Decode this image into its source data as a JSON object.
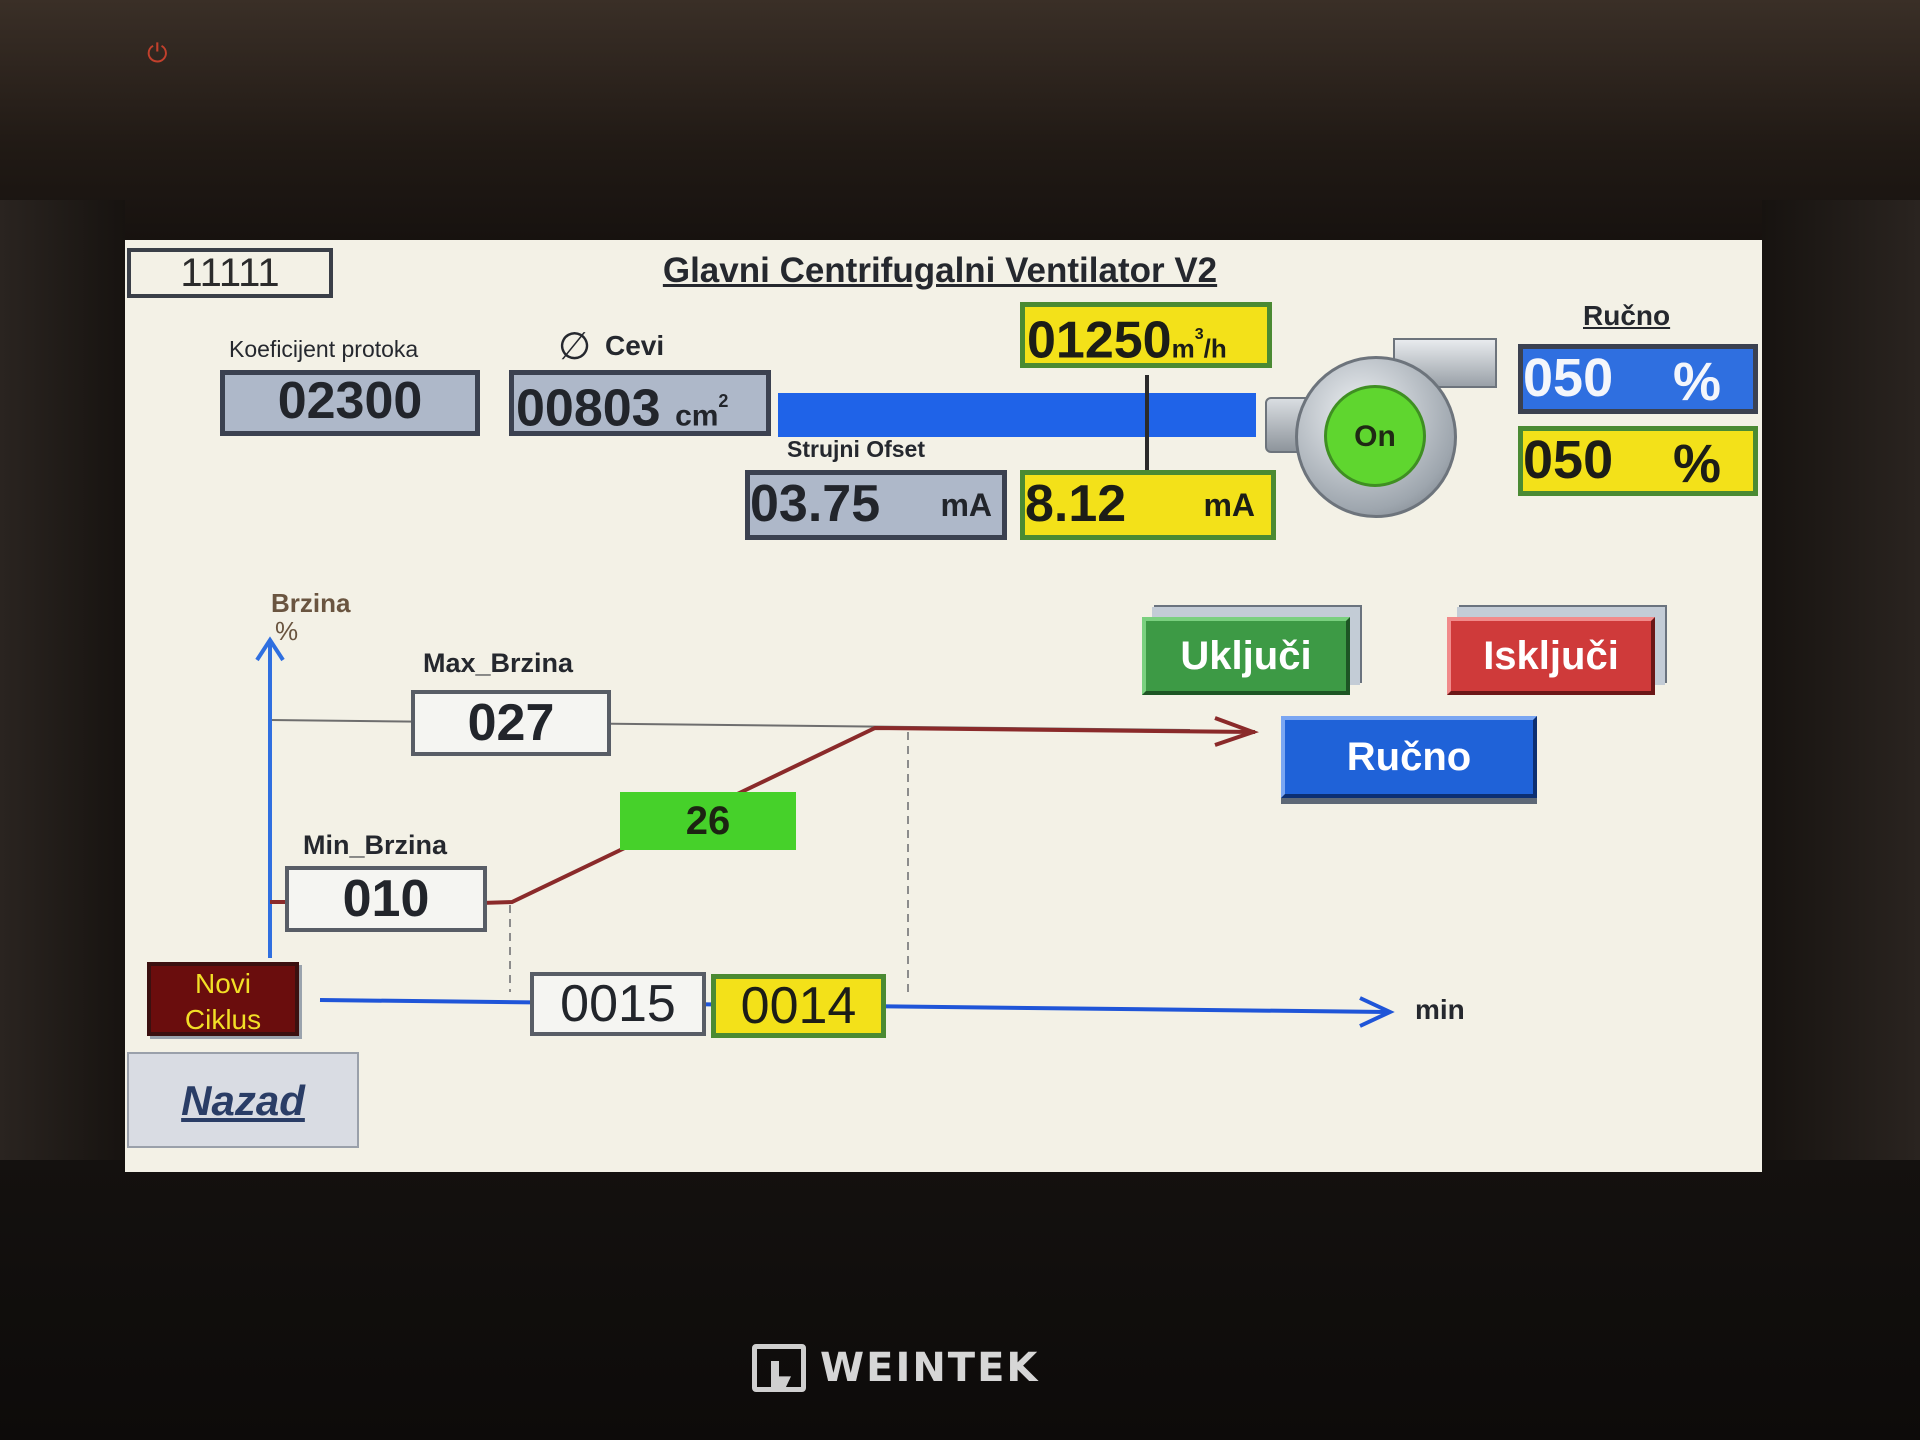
{
  "device": {
    "brand": "WEINTEK"
  },
  "header": {
    "id_value": "11111",
    "title": "Glavni Centrifugalni Ventilator  V2"
  },
  "flow_section": {
    "koef_label": "Koeficijent protoka",
    "koef_value": "02300",
    "cevi_symbol": "∅",
    "cevi_label": "Cevi",
    "cevi_value": "00803",
    "cevi_unit": "cm",
    "cevi_unit_sup": "2",
    "flow_value": "01250",
    "flow_unit": "m",
    "flow_unit_sup": "3",
    "flow_unit_tail": "/h",
    "strujni_label": "Strujni Ofset",
    "offset_value": "03.75",
    "offset_unit": "mA",
    "current_value": "8.12",
    "current_unit": "mA"
  },
  "fan": {
    "status": "On",
    "status_color": "#5fd62f"
  },
  "manual_panel": {
    "label": "Ručno",
    "setpoint_value": "050",
    "setpoint_unit": "%",
    "actual_value": "050",
    "actual_unit": "%"
  },
  "buttons": {
    "ukljuci": "Uključi",
    "iskljuci": "Isključi",
    "rucno": "Ručno",
    "novi_ciklus_line1": "Novi",
    "novi_ciklus_line2": "Ciklus",
    "nazad": "Nazad"
  },
  "speed_profile": {
    "y_axis_label": "Brzina",
    "y_axis_unit": "%",
    "x_axis_unit": "min",
    "max_label": "Max_Brzina",
    "max_value": "027",
    "min_label": "Min_Brzina",
    "min_value": "010",
    "current_speed": "26",
    "ramp_time_set": "0015",
    "ramp_time_elapsed": "0014"
  },
  "colors": {
    "screen_bg": "#f3f1e6",
    "accent_blue": "#1f63e8",
    "accent_yellow": "#f3e119",
    "accent_green": "#46d12a",
    "accent_red": "#cf3a3a",
    "profile_line": "#8a2a2a"
  }
}
